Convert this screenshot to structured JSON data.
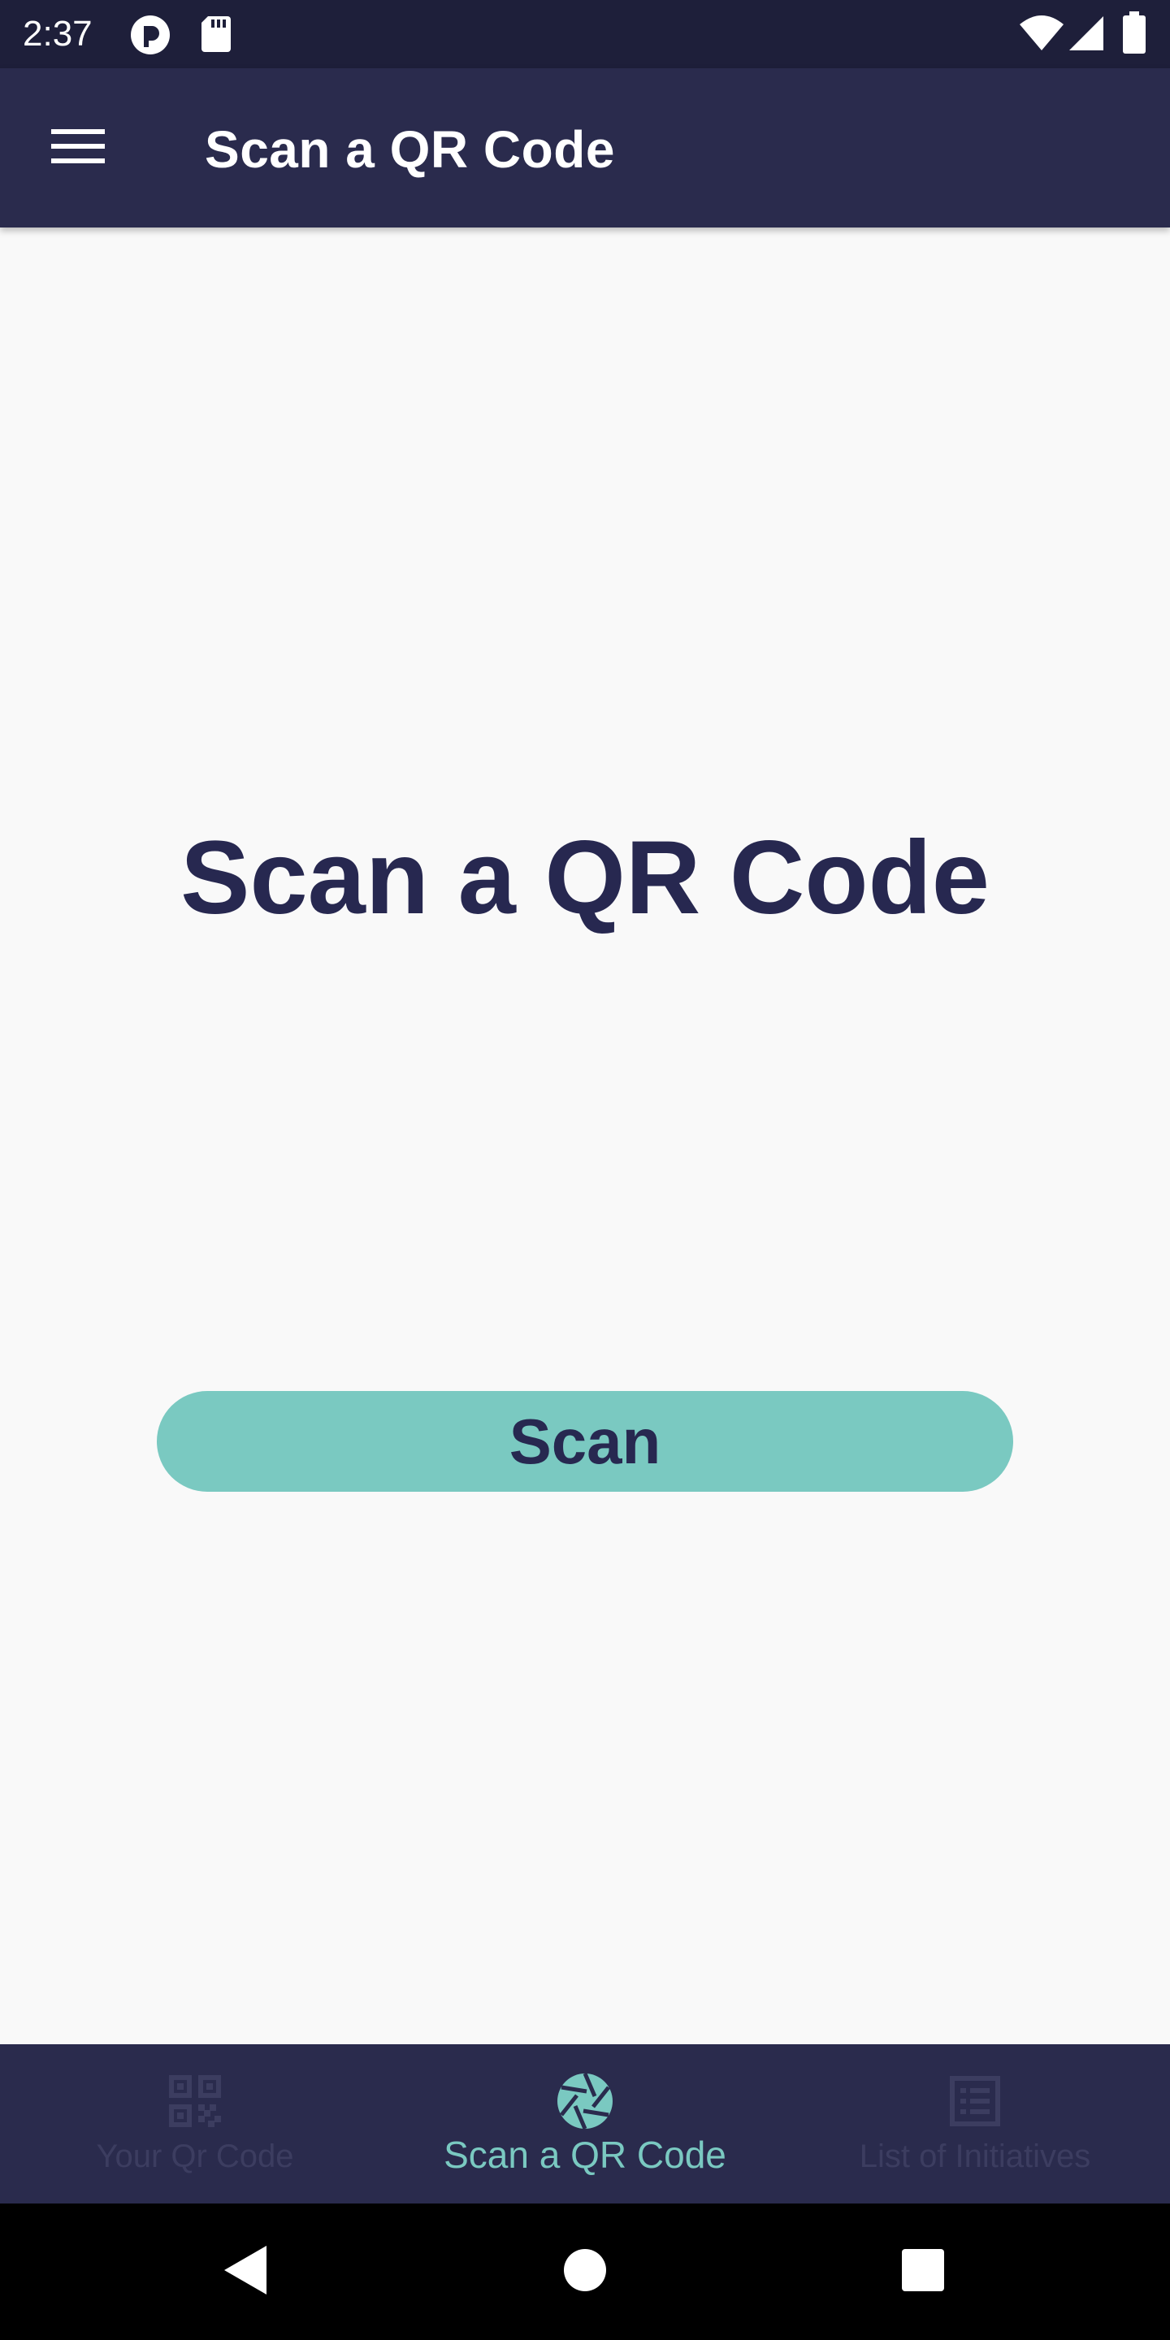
{
  "status_bar": {
    "time": "2:37"
  },
  "app_bar": {
    "title": "Scan a QR Code",
    "menu_icon": "hamburger-menu-icon"
  },
  "main": {
    "heading": "Scan a QR Code",
    "scan_button_label": "Scan"
  },
  "bottom_nav": {
    "items": [
      {
        "label": "Your Qr Code",
        "icon": "qr-code-icon",
        "active": false
      },
      {
        "label": "Scan a QR Code",
        "icon": "camera-shutter-icon",
        "active": true
      },
      {
        "label": "List of Initiatives",
        "icon": "list-icon",
        "active": false
      }
    ]
  },
  "colors": {
    "status_bar_bg": "#1e1f3a",
    "app_bar_bg": "#2a2b4d",
    "page_bg": "#f9f9f9",
    "heading_text": "#272850",
    "accent": "#7ac9c1",
    "nav_inactive": "#3c3d60"
  }
}
